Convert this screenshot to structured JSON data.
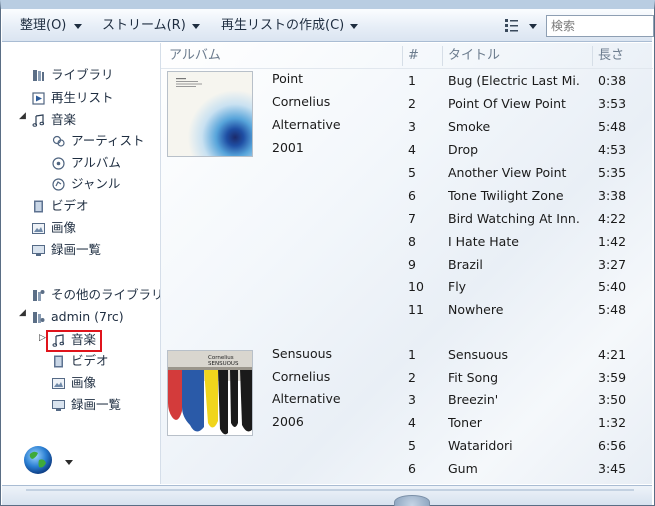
{
  "toolbar": {
    "organize": "整理(O)",
    "stream": "ストリーム(R)",
    "create_playlist": "再生リストの作成(C)",
    "search_placeholder": "検索"
  },
  "nav": {
    "library": "ライブラリ",
    "playlists": "再生リスト",
    "music": "音楽",
    "artist": "アーティスト",
    "album": "アルバム",
    "genre": "ジャンル",
    "video": "ビデオ",
    "pictures": "画像",
    "recorded_tv": "録画一覧",
    "other_libraries": "その他のライブラリ",
    "remote_user": "admin (7rc)",
    "remote_music": "音楽",
    "remote_video": "ビデオ",
    "remote_pictures": "画像",
    "remote_recorded_tv": "録画一覧"
  },
  "columns": {
    "album": "アルバム",
    "number": "#",
    "title": "タイトル",
    "length": "長さ"
  },
  "albums": [
    {
      "title": "Point",
      "artist": "Cornelius",
      "genre": "Alternative",
      "year": "2001",
      "tracks": [
        {
          "n": "1",
          "title": "Bug (Electric Last Mi...",
          "len": "0:38"
        },
        {
          "n": "2",
          "title": "Point Of View Point",
          "len": "3:53"
        },
        {
          "n": "3",
          "title": "Smoke",
          "len": "5:48"
        },
        {
          "n": "4",
          "title": "Drop",
          "len": "4:53"
        },
        {
          "n": "5",
          "title": "Another View Point",
          "len": "5:35"
        },
        {
          "n": "6",
          "title": "Tone Twilight Zone",
          "len": "3:38"
        },
        {
          "n": "7",
          "title": "Bird Watching At Inn...",
          "len": "4:22"
        },
        {
          "n": "8",
          "title": "I Hate Hate",
          "len": "1:42"
        },
        {
          "n": "9",
          "title": "Brazil",
          "len": "3:27"
        },
        {
          "n": "10",
          "title": "Fly",
          "len": "5:40"
        },
        {
          "n": "11",
          "title": "Nowhere",
          "len": "5:48"
        }
      ]
    },
    {
      "title": "Sensuous",
      "artist": "Cornelius",
      "genre": "Alternative",
      "year": "2006",
      "cover_text": [
        "Cornelius",
        "SENSUOUS"
      ],
      "tracks": [
        {
          "n": "1",
          "title": "Sensuous",
          "len": "4:21"
        },
        {
          "n": "2",
          "title": "Fit Song",
          "len": "3:59"
        },
        {
          "n": "3",
          "title": "Breezin'",
          "len": "3:50"
        },
        {
          "n": "4",
          "title": "Toner",
          "len": "1:32"
        },
        {
          "n": "5",
          "title": "Wataridori",
          "len": "6:56"
        },
        {
          "n": "6",
          "title": "Gum",
          "len": "3:45"
        }
      ]
    }
  ],
  "icons": {
    "library": "library-icon",
    "playlist": "playlist-icon",
    "music": "music-note-icon",
    "artist": "artist-icon",
    "album": "album-icon",
    "genre": "genre-icon",
    "video": "video-icon",
    "pictures": "pictures-icon",
    "recorded_tv": "recorded-tv-icon",
    "globe": "online-stores-globe-icon"
  },
  "colors": {
    "highlight_box": "#e0141c",
    "toolbar_text": "#1e2d40",
    "header_text": "#6c7c8e"
  }
}
